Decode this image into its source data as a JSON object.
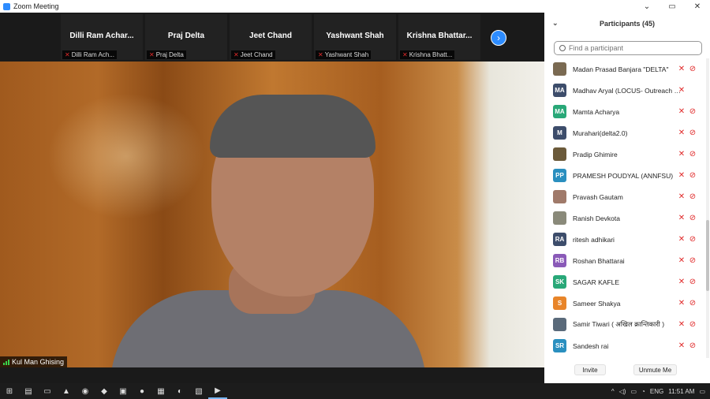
{
  "window": {
    "title": "Zoom Meeting",
    "controls": [
      "⌄",
      "▭",
      "✕"
    ]
  },
  "gallery": {
    "tiles": [
      {
        "name": "Dilli  Ram  Achar...",
        "label": "Dilli Ram Ach..."
      },
      {
        "name": "Praj Delta",
        "label": "Praj Delta"
      },
      {
        "name": "Jeet Chand",
        "label": "Jeet Chand"
      },
      {
        "name": "Yashwant Shah",
        "label": "Yashwant Shah"
      },
      {
        "name": "Krishna  Bhattar...",
        "label": "Krishna Bhatt..."
      }
    ],
    "next_icon": "›"
  },
  "speaker": {
    "name": "Kul Man Ghising"
  },
  "participants": {
    "title": "Participants (45)",
    "collapse_icon": "⌄",
    "search_placeholder": "Find a participant",
    "items": [
      {
        "name": "Madan Prasad Banjara \"DELTA\"",
        "initials": "",
        "color": "#7a6a52",
        "video_off": true
      },
      {
        "name": "Madhav Aryal (LOCUS- Outreach M...",
        "initials": "MA",
        "color": "#3d4d6b",
        "video_off": false
      },
      {
        "name": "Mamta Acharya",
        "initials": "MA",
        "color": "#29a878",
        "video_off": true
      },
      {
        "name": "Murahari(delta2.0)",
        "initials": "M",
        "color": "#3d4d6b",
        "video_off": true
      },
      {
        "name": "Pradip Ghimire",
        "initials": "",
        "color": "#6b5a3a",
        "video_off": true
      },
      {
        "name": "PRAMESH POUDYAL (ANNFSU)",
        "initials": "PP",
        "color": "#2a8fbf",
        "video_off": true
      },
      {
        "name": "Pravash Gautam",
        "initials": "",
        "color": "#a07a6a",
        "video_off": true
      },
      {
        "name": "Ranish Devkota",
        "initials": "",
        "color": "#8a8a7a",
        "video_off": true
      },
      {
        "name": "ritesh adhikari",
        "initials": "RA",
        "color": "#3d4d6b",
        "video_off": true
      },
      {
        "name": "Roshan Bhattarai",
        "initials": "RB",
        "color": "#8a5ab8",
        "video_off": true
      },
      {
        "name": "SAGAR KAFLE",
        "initials": "SK",
        "color": "#29a878",
        "video_off": true
      },
      {
        "name": "Sameer Shakya",
        "initials": "S",
        "color": "#e8852a",
        "video_off": true
      },
      {
        "name": "Samir Tiwari ( अखिल क्रान्तिकारी )",
        "initials": "",
        "color": "#5a6a7a",
        "video_off": true
      },
      {
        "name": "Sandesh rai",
        "initials": "SR",
        "color": "#2a8fbf",
        "video_off": true
      }
    ],
    "invite_label": "Invite",
    "unmute_label": "Unmute Me"
  },
  "taskbar": {
    "start_icon": "⊞",
    "apps": [
      "▤",
      "▭",
      "▲",
      "◉",
      "◆",
      "▣",
      "●",
      "▦",
      "◐",
      "▧",
      "▶"
    ],
    "tray": {
      "caret": "^",
      "language": "ENG",
      "time": "11:51 AM",
      "notification_icon": "▭"
    }
  }
}
